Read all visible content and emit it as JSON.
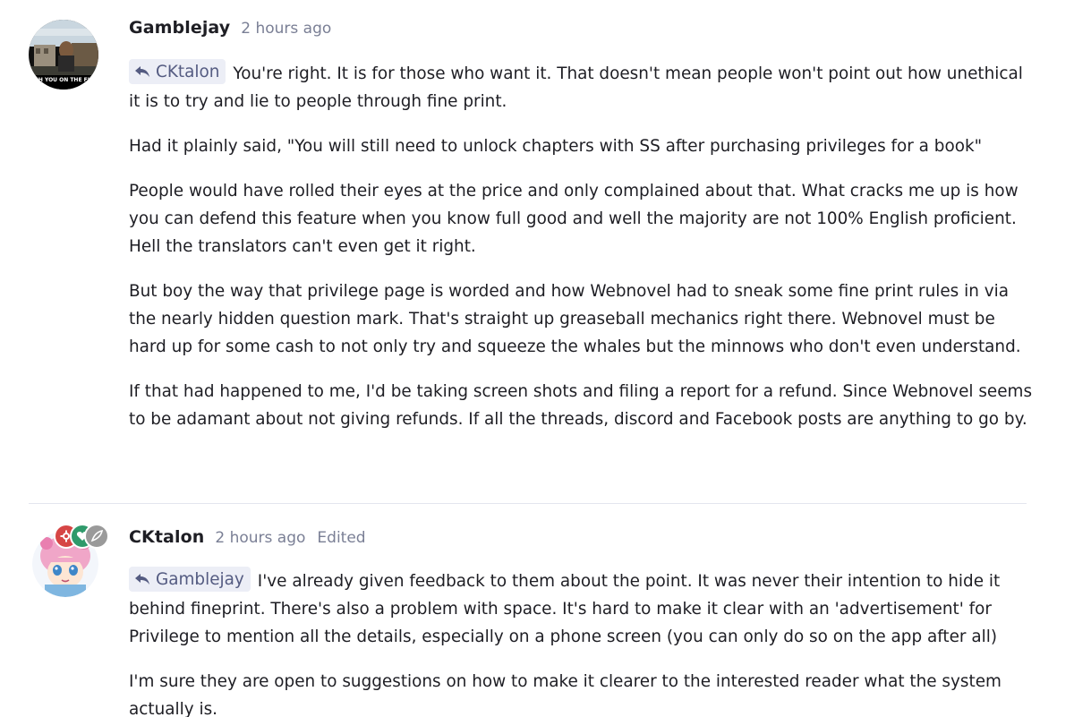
{
  "posts": [
    {
      "author": "Gamblejay",
      "time": "2 hours ago",
      "avatar_icon": "user-photo-avatar",
      "reply_to": "CKtalon",
      "paragraphs": [
        "You're right. It is for those who want it. That doesn't mean people won't point out how unethical it is to try and lie to people through fine print.",
        "Had it plainly said, \"You will still need to unlock chapters with SS after purchasing privileges for a book\"",
        "People would have rolled their eyes at the price and only complained about that. What cracks me up is how you can defend this feature when you know full good and well the majority are not 100% English proficient. Hell the translators can't even get it right.",
        "But boy the way that privilege page is worded and how Webnovel had to sneak some fine print rules in via the nearly hidden question mark. That's straight up greaseball mechanics right there. Webnovel must be hard up for some cash to not only try and squeeze the whales but the minnows who don't even understand.",
        "If that had happened to me, I'd be taking screen shots and filing a report for a refund. Since Webnovel seems to be adamant about not giving refunds. If all the threads, discord and Facebook posts are anything to go by."
      ]
    },
    {
      "author": "CKtalon",
      "time": "2 hours ago",
      "edited": "Edited",
      "avatar_icon": "anime-character-avatar",
      "reply_to": "Gamblejay",
      "paragraphs": [
        "I've already given feedback to them about the point. It was never their intention to hide it behind fineprint. There's also a problem with space. It's hard to make it clear with an 'advertisement' for Privilege to mention all the details, especially on a phone screen (you can only do so on the app after all)",
        "I'm sure they are open to suggestions on how to make it clearer to the interested reader what the system actually is."
      ]
    }
  ],
  "colors": {
    "text": "#1e1e24",
    "muted": "#7a7f95",
    "reply_tag_bg": "#eceef6",
    "reply_tag_fg": "#545b81",
    "divider": "#e3e5ee"
  }
}
